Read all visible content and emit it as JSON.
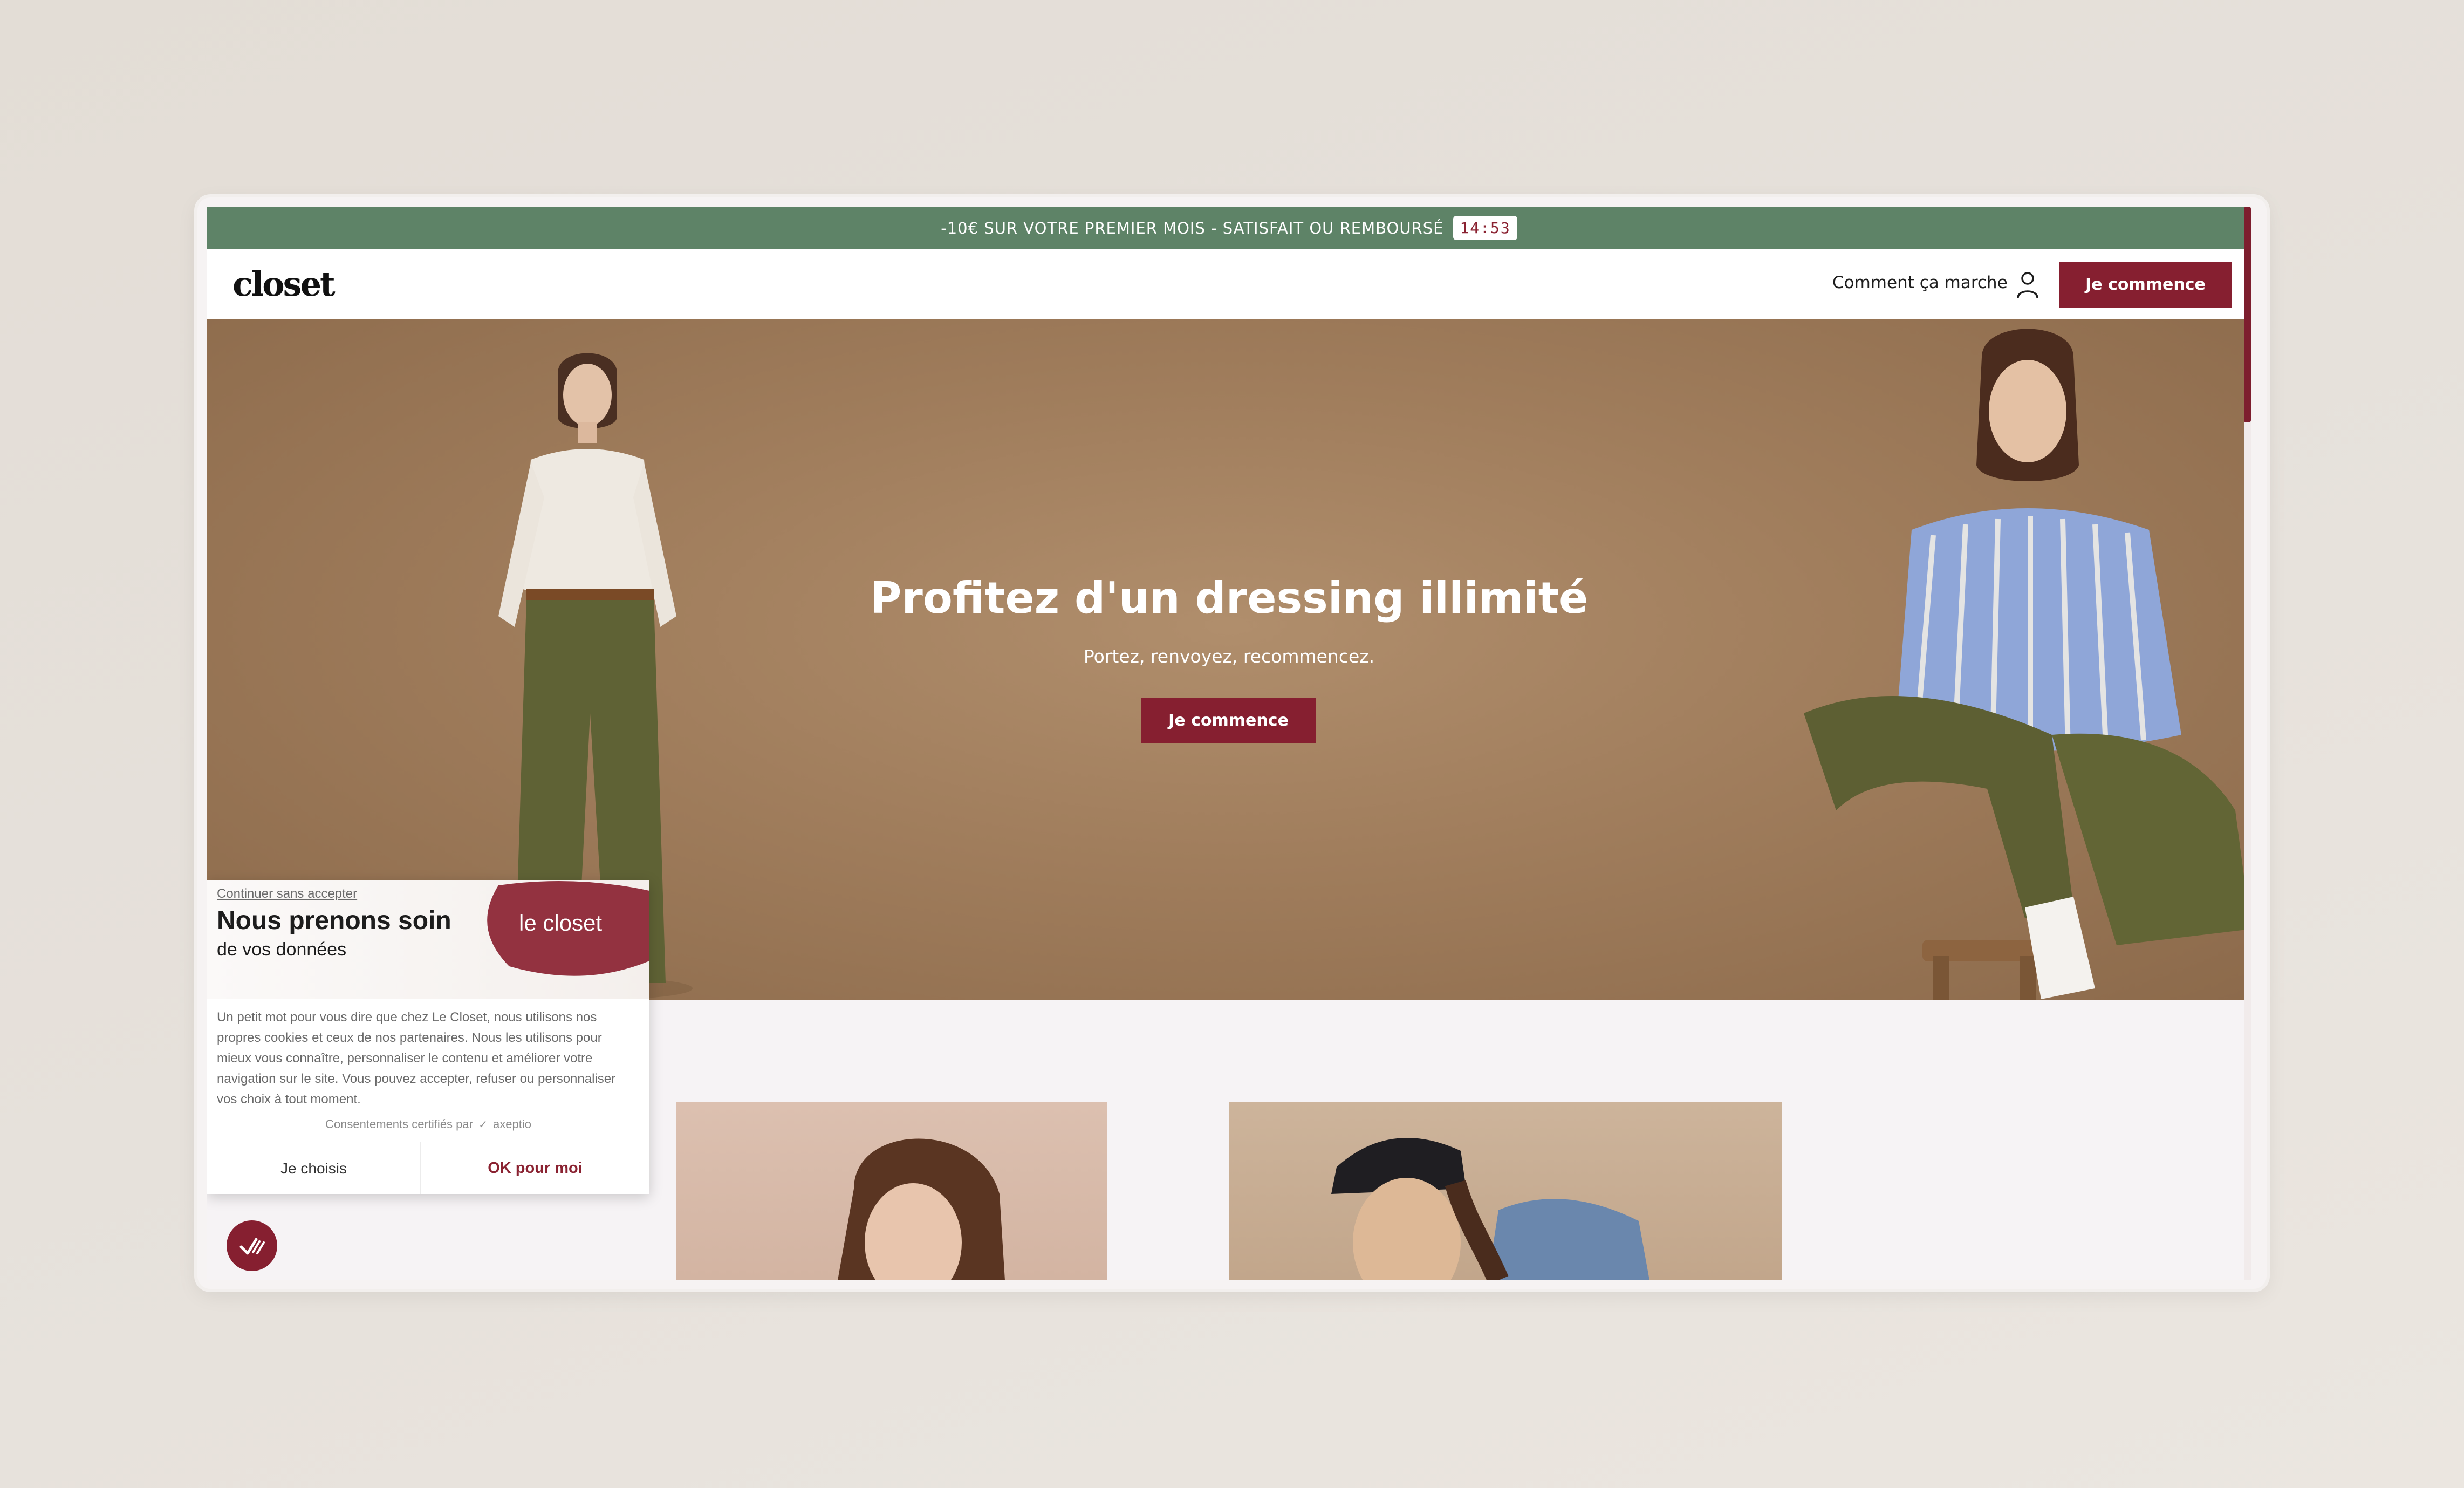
{
  "promo": {
    "text": "-10€ SUR VOTRE PREMIER MOIS - SATISFAIT OU REMBOURSÉ",
    "countdown": "14:53"
  },
  "header": {
    "logo": "closet",
    "nav_link": "Comment ça marche",
    "cta": "Je commence"
  },
  "hero": {
    "title": "Profitez d'un dressing illimité",
    "subtitle": "Portez, renvoyez, recommencez.",
    "cta": "Je commence"
  },
  "cookie": {
    "skip_link": "Continuer sans accepter",
    "title": "Nous prenons soin",
    "subtitle": "de vos données",
    "brand": "le closet",
    "body": "Un petit mot pour vous dire que chez Le Closet, nous utilisons nos propres cookies et ceux de nos partenaires. Nous les utilisons pour mieux vous connaître, personnaliser le contenu et améliorer votre navigation sur le site.  Vous pouvez accepter, refuser ou personnaliser vos choix à tout moment.",
    "certified_label": "Consentements certifiés par",
    "certified_brand": "axeptio",
    "choose_button": "Je choisis",
    "accept_button": "OK pour moi"
  },
  "colors": {
    "promo_bg": "#5e8367",
    "brand_burgundy": "#861f30",
    "hero_bg": "#a07d5c"
  },
  "icons": {
    "user": "user-icon",
    "axeptio": "axeptio-check-icon"
  }
}
